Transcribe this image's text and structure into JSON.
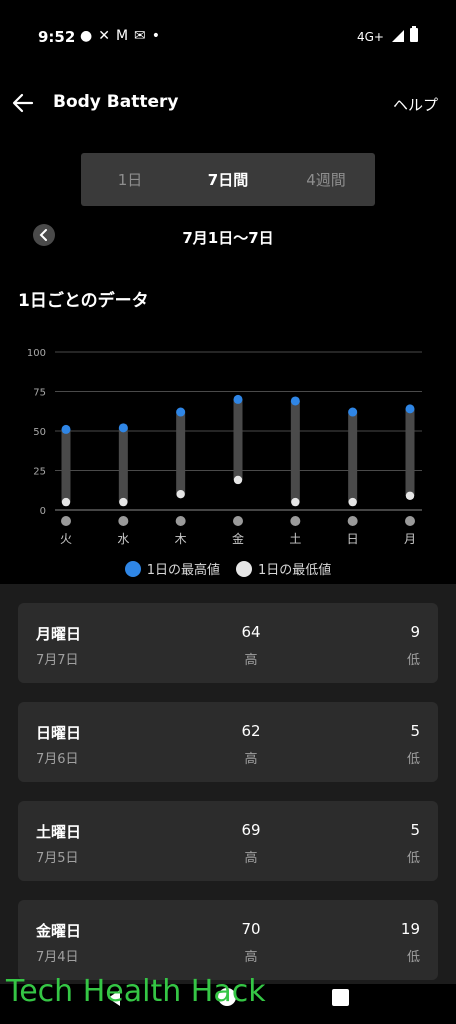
{
  "status_bar": {
    "time": "9:52",
    "icons": [
      "chat-icon",
      "x-icon",
      "gmail-icon",
      "mail-icon",
      "dot"
    ],
    "network": "4G+"
  },
  "header": {
    "title": "Body Battery",
    "help": "ヘルプ"
  },
  "tabs": [
    {
      "label": "1日",
      "active": false
    },
    {
      "label": "7日間",
      "active": true
    },
    {
      "label": "4週間",
      "active": false
    }
  ],
  "date_range": "7月1日〜7日",
  "section_title": "1日ごとのデータ",
  "chart_data": {
    "type": "range-bar",
    "categories": [
      "火",
      "水",
      "木",
      "金",
      "土",
      "日",
      "月"
    ],
    "series": [
      {
        "name": "1日の最高値",
        "color": "#2f86e6",
        "values": [
          51,
          52,
          62,
          70,
          69,
          62,
          64
        ]
      },
      {
        "name": "1日の最低値",
        "color": "#e6e6e6",
        "values": [
          5,
          5,
          10,
          19,
          5,
          5,
          9
        ]
      }
    ],
    "ylim": [
      0,
      100
    ],
    "yticks": [
      0,
      25,
      50,
      75,
      100
    ],
    "grid": true,
    "legend": "bottom"
  },
  "legend": {
    "high": "1日の最高値",
    "low": "1日の最低値"
  },
  "cards": [
    {
      "day": "月曜日",
      "date": "7月7日",
      "high": "64",
      "high_label": "高",
      "low": "9",
      "low_label": "低"
    },
    {
      "day": "日曜日",
      "date": "7月6日",
      "high": "62",
      "high_label": "高",
      "low": "5",
      "low_label": "低"
    },
    {
      "day": "土曜日",
      "date": "7月5日",
      "high": "69",
      "high_label": "高",
      "low": "5",
      "low_label": "低"
    },
    {
      "day": "金曜日",
      "date": "7月4日",
      "high": "70",
      "high_label": "高",
      "low": "19",
      "low_label": "低"
    }
  ],
  "watermark": "Tech Health Hack"
}
